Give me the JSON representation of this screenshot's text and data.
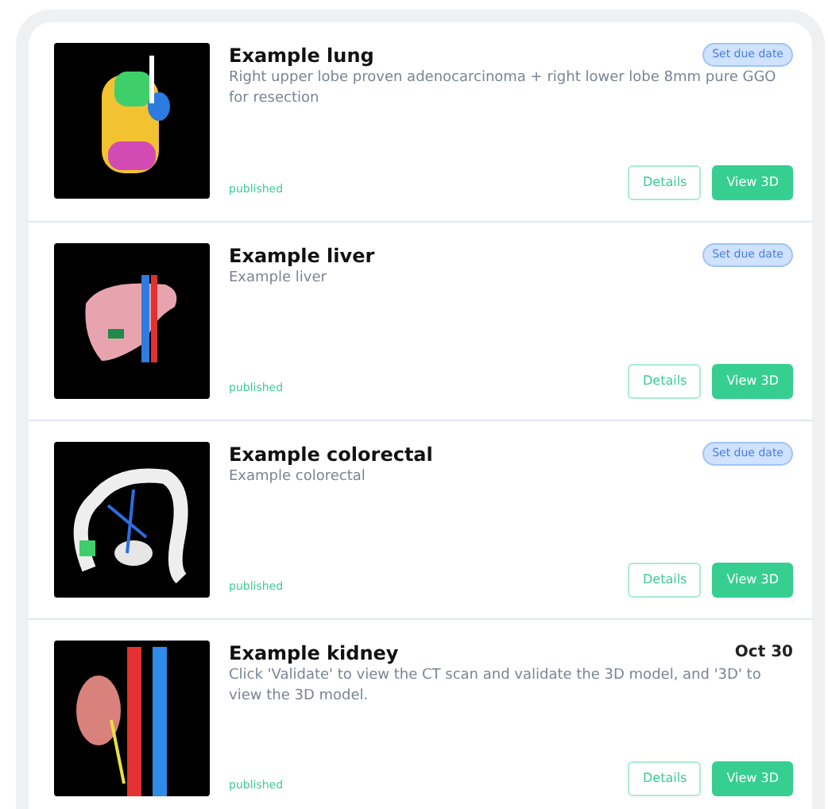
{
  "cases": [
    {
      "title": "Example lung",
      "description": "Right upper lobe proven adenocarcinoma + right lower lobe 8mm pure GGO for resection",
      "tag": {
        "kind": "badge",
        "text": "Set due date"
      },
      "status": "published",
      "kind": "lung",
      "buttons": [
        "Details",
        "View 3D"
      ]
    },
    {
      "title": "Example liver",
      "description": "Example liver",
      "tag": {
        "kind": "badge",
        "text": "Set due date"
      },
      "status": "published",
      "kind": "liver",
      "buttons": [
        "Details",
        "View 3D"
      ]
    },
    {
      "title": "Example colorectal",
      "description": "Example colorectal",
      "tag": {
        "kind": "badge",
        "text": "Set due date"
      },
      "status": "published",
      "kind": "colon",
      "buttons": [
        "Details",
        "View 3D"
      ]
    },
    {
      "title": "Example kidney",
      "description": "Click 'Validate' to view the CT scan and validate the 3D model, and '3D' to view the 3D model.",
      "tag": {
        "kind": "date",
        "text": "Oct 30"
      },
      "status": "published",
      "kind": "kidney",
      "buttons": [
        "Details",
        "View 3D"
      ]
    }
  ]
}
